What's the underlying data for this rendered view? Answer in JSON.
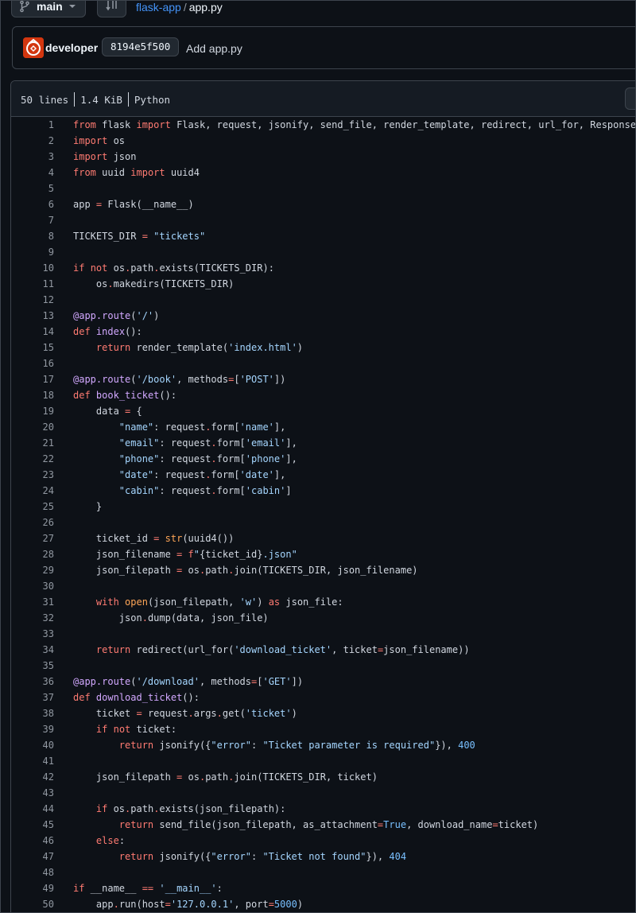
{
  "topbar": {
    "branch_label": "main",
    "breadcrumb_repo": "flask-app",
    "breadcrumb_sep": "/",
    "breadcrumb_file": "app.py"
  },
  "commit": {
    "author": "developer",
    "sha": "8194e5f500",
    "message": "Add app.py"
  },
  "file": {
    "lines_label": "50 lines",
    "size_label": "1.4 KiB",
    "language_label": "Python"
  },
  "code_lines": [
    "from flask import Flask, request, jsonify, send_file, render_template, redirect, url_for, Response",
    "import os",
    "import json",
    "from uuid import uuid4",
    "",
    "app = Flask(__name__)",
    "",
    "TICKETS_DIR = \"tickets\"",
    "",
    "if not os.path.exists(TICKETS_DIR):",
    "    os.makedirs(TICKETS_DIR)",
    "",
    "@app.route('/')",
    "def index():",
    "    return render_template('index.html')",
    "",
    "@app.route('/book', methods=['POST'])",
    "def book_ticket():",
    "    data = {",
    "        \"name\": request.form['name'],",
    "        \"email\": request.form['email'],",
    "        \"phone\": request.form['phone'],",
    "        \"date\": request.form['date'],",
    "        \"cabin\": request.form['cabin']",
    "    }",
    "",
    "    ticket_id = str(uuid4())",
    "    json_filename = f\"{ticket_id}.json\"",
    "    json_filepath = os.path.join(TICKETS_DIR, json_filename)",
    "",
    "    with open(json_filepath, 'w') as json_file:",
    "        json.dump(data, json_file)",
    "",
    "    return redirect(url_for('download_ticket', ticket=json_filename))",
    "",
    "@app.route('/download', methods=['GET'])",
    "def download_ticket():",
    "    ticket = request.args.get('ticket')",
    "    if not ticket:",
    "        return jsonify({\"error\": \"Ticket parameter is required\"}), 400",
    "",
    "    json_filepath = os.path.join(TICKETS_DIR, ticket)",
    "",
    "    if os.path.exists(json_filepath):",
    "        return send_file(json_filepath, as_attachment=True, download_name=ticket)",
    "    else:",
    "        return jsonify({\"error\": \"Ticket not found\"}), 404",
    "",
    "if __name__ == '__main__':",
    "    app.run(host='127.0.0.1', port=5000)"
  ],
  "colors": {
    "background": "#0d1117",
    "border": "#3d444d",
    "keyword": "#ff7b72",
    "string": "#a5d6ff",
    "function": "#d2a8ff",
    "number": "#79c0ff",
    "link": "#4493f8"
  },
  "icons": {
    "branch": "git-branch-icon",
    "caret": "triangle-down-icon",
    "tree": "file-tree-icon"
  }
}
